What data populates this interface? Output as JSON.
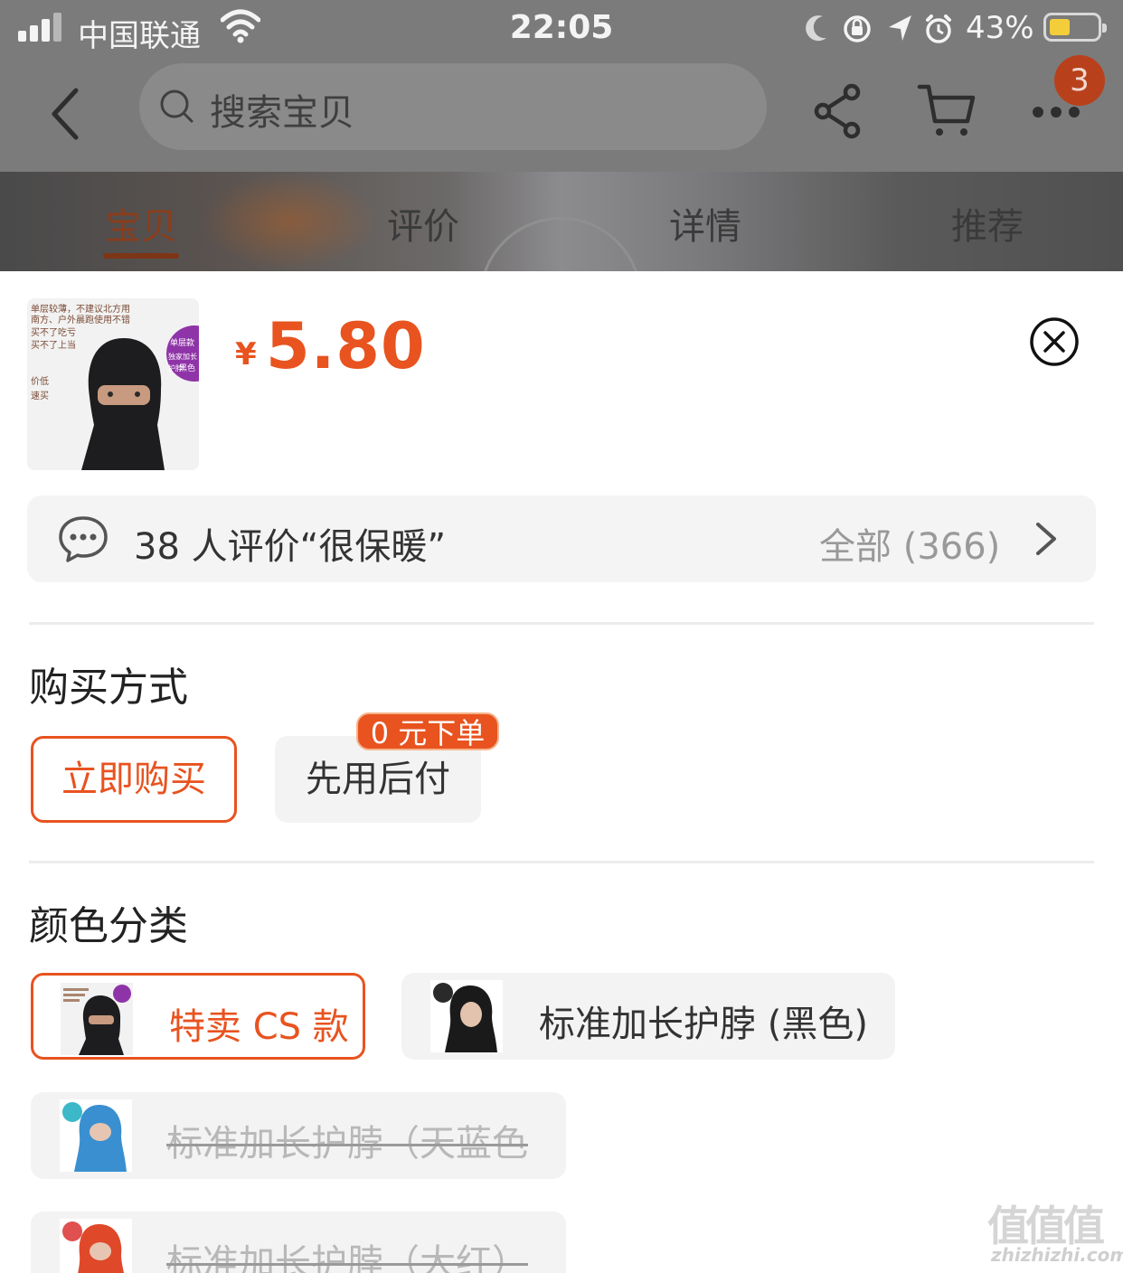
{
  "status_bar": {
    "carrier": "中国联通",
    "time": "22:05",
    "battery_percent": "43%",
    "battery_level": 0.43
  },
  "nav": {
    "search_placeholder": "搜索宝贝",
    "cart_badge_count": "3"
  },
  "tabs": [
    {
      "label": "宝贝",
      "active": true
    },
    {
      "label": "评价",
      "active": false
    },
    {
      "label": "详情",
      "active": false
    },
    {
      "label": "推荐",
      "active": false
    }
  ],
  "product": {
    "currency_symbol": "¥",
    "price": "5.80",
    "thumbnail_text": [
      "单层较薄，不建议北方用",
      "南方、户外晨跑使用不错",
      "买不了吃亏",
      "买不了上当",
      "价低",
      "速买",
      "单层款",
      "独家加长护脖",
      "黑色"
    ]
  },
  "review_summary": {
    "text": "38 人评价“很保暖”",
    "all_label": "全部 (366)"
  },
  "purchase_method": {
    "title": "购买方式",
    "options": [
      {
        "label": "立即购买",
        "selected": true
      },
      {
        "label": "先用后付",
        "selected": false,
        "badge": "0 元下单"
      }
    ]
  },
  "color_category": {
    "title": "颜色分类",
    "options": [
      {
        "label": "特卖 CS 款",
        "state": "selected",
        "image": "black-balaclava-thumb"
      },
      {
        "label": "标准加长护脖 (黑色)",
        "state": "available",
        "image": "black-hood-thumb"
      },
      {
        "label": "标准加长护脖（天蓝色",
        "state": "disabled",
        "image": "sky-blue-hood-thumb"
      },
      {
        "label": "标准加长护脖（大红）",
        "state": "disabled",
        "image": "red-hood-thumb"
      }
    ]
  },
  "watermark": {
    "big": "值值值",
    "small": "zhizhizhi.com"
  },
  "colors": {
    "accent": "#e8531f",
    "price": "#e8531f",
    "disabled_text": "#b8b8b8",
    "option_bg": "#f3f3f3",
    "overlay": "#7b7b7b"
  }
}
